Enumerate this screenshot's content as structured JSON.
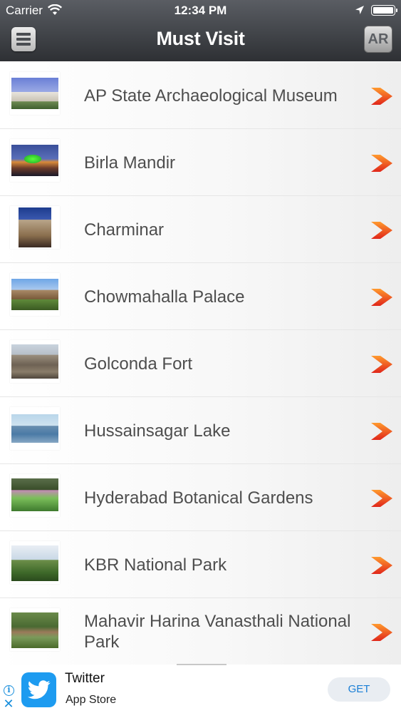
{
  "status_bar": {
    "carrier": "Carrier",
    "time": "12:34 PM",
    "icons": [
      "wifi-icon",
      "location-icon",
      "battery-icon"
    ]
  },
  "nav": {
    "title": "Must Visit",
    "menu_icon": "hamburger-menu-icon",
    "ar_label": "AR"
  },
  "list": {
    "chevron_color": "#e8371c",
    "items": [
      {
        "label": "AP State Archaeological Museum"
      },
      {
        "label": "Birla Mandir"
      },
      {
        "label": "Charminar"
      },
      {
        "label": "Chowmahalla Palace"
      },
      {
        "label": "Golconda Fort"
      },
      {
        "label": "Hussainsagar Lake"
      },
      {
        "label": "Hyderabad Botanical Gardens"
      },
      {
        "label": "KBR National Park"
      },
      {
        "label": "Mahavir Harina Vanasthali National Park"
      }
    ]
  },
  "ad": {
    "title": "Twitter",
    "subtitle": "App Store",
    "cta": "GET",
    "icon": "twitter-bird-icon",
    "accent": "#1d9bf0"
  }
}
